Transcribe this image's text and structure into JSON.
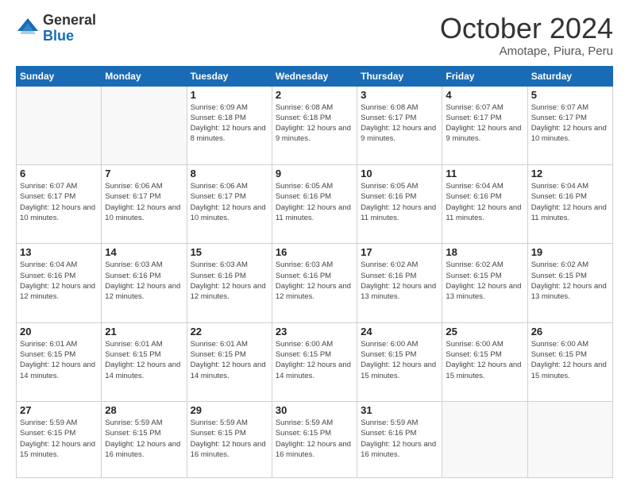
{
  "header": {
    "logo_general": "General",
    "logo_blue": "Blue",
    "month_year": "October 2024",
    "location": "Amotape, Piura, Peru"
  },
  "days_of_week": [
    "Sunday",
    "Monday",
    "Tuesday",
    "Wednesday",
    "Thursday",
    "Friday",
    "Saturday"
  ],
  "weeks": [
    [
      {
        "day": "",
        "info": ""
      },
      {
        "day": "",
        "info": ""
      },
      {
        "day": "1",
        "info": "Sunrise: 6:09 AM\nSunset: 6:18 PM\nDaylight: 12 hours and 8 minutes."
      },
      {
        "day": "2",
        "info": "Sunrise: 6:08 AM\nSunset: 6:18 PM\nDaylight: 12 hours and 9 minutes."
      },
      {
        "day": "3",
        "info": "Sunrise: 6:08 AM\nSunset: 6:17 PM\nDaylight: 12 hours and 9 minutes."
      },
      {
        "day": "4",
        "info": "Sunrise: 6:07 AM\nSunset: 6:17 PM\nDaylight: 12 hours and 9 minutes."
      },
      {
        "day": "5",
        "info": "Sunrise: 6:07 AM\nSunset: 6:17 PM\nDaylight: 12 hours and 10 minutes."
      }
    ],
    [
      {
        "day": "6",
        "info": "Sunrise: 6:07 AM\nSunset: 6:17 PM\nDaylight: 12 hours and 10 minutes."
      },
      {
        "day": "7",
        "info": "Sunrise: 6:06 AM\nSunset: 6:17 PM\nDaylight: 12 hours and 10 minutes."
      },
      {
        "day": "8",
        "info": "Sunrise: 6:06 AM\nSunset: 6:17 PM\nDaylight: 12 hours and 10 minutes."
      },
      {
        "day": "9",
        "info": "Sunrise: 6:05 AM\nSunset: 6:16 PM\nDaylight: 12 hours and 11 minutes."
      },
      {
        "day": "10",
        "info": "Sunrise: 6:05 AM\nSunset: 6:16 PM\nDaylight: 12 hours and 11 minutes."
      },
      {
        "day": "11",
        "info": "Sunrise: 6:04 AM\nSunset: 6:16 PM\nDaylight: 12 hours and 11 minutes."
      },
      {
        "day": "12",
        "info": "Sunrise: 6:04 AM\nSunset: 6:16 PM\nDaylight: 12 hours and 11 minutes."
      }
    ],
    [
      {
        "day": "13",
        "info": "Sunrise: 6:04 AM\nSunset: 6:16 PM\nDaylight: 12 hours and 12 minutes."
      },
      {
        "day": "14",
        "info": "Sunrise: 6:03 AM\nSunset: 6:16 PM\nDaylight: 12 hours and 12 minutes."
      },
      {
        "day": "15",
        "info": "Sunrise: 6:03 AM\nSunset: 6:16 PM\nDaylight: 12 hours and 12 minutes."
      },
      {
        "day": "16",
        "info": "Sunrise: 6:03 AM\nSunset: 6:16 PM\nDaylight: 12 hours and 12 minutes."
      },
      {
        "day": "17",
        "info": "Sunrise: 6:02 AM\nSunset: 6:16 PM\nDaylight: 12 hours and 13 minutes."
      },
      {
        "day": "18",
        "info": "Sunrise: 6:02 AM\nSunset: 6:15 PM\nDaylight: 12 hours and 13 minutes."
      },
      {
        "day": "19",
        "info": "Sunrise: 6:02 AM\nSunset: 6:15 PM\nDaylight: 12 hours and 13 minutes."
      }
    ],
    [
      {
        "day": "20",
        "info": "Sunrise: 6:01 AM\nSunset: 6:15 PM\nDaylight: 12 hours and 14 minutes."
      },
      {
        "day": "21",
        "info": "Sunrise: 6:01 AM\nSunset: 6:15 PM\nDaylight: 12 hours and 14 minutes."
      },
      {
        "day": "22",
        "info": "Sunrise: 6:01 AM\nSunset: 6:15 PM\nDaylight: 12 hours and 14 minutes."
      },
      {
        "day": "23",
        "info": "Sunrise: 6:00 AM\nSunset: 6:15 PM\nDaylight: 12 hours and 14 minutes."
      },
      {
        "day": "24",
        "info": "Sunrise: 6:00 AM\nSunset: 6:15 PM\nDaylight: 12 hours and 15 minutes."
      },
      {
        "day": "25",
        "info": "Sunrise: 6:00 AM\nSunset: 6:15 PM\nDaylight: 12 hours and 15 minutes."
      },
      {
        "day": "26",
        "info": "Sunrise: 6:00 AM\nSunset: 6:15 PM\nDaylight: 12 hours and 15 minutes."
      }
    ],
    [
      {
        "day": "27",
        "info": "Sunrise: 5:59 AM\nSunset: 6:15 PM\nDaylight: 12 hours and 15 minutes."
      },
      {
        "day": "28",
        "info": "Sunrise: 5:59 AM\nSunset: 6:15 PM\nDaylight: 12 hours and 16 minutes."
      },
      {
        "day": "29",
        "info": "Sunrise: 5:59 AM\nSunset: 6:15 PM\nDaylight: 12 hours and 16 minutes."
      },
      {
        "day": "30",
        "info": "Sunrise: 5:59 AM\nSunset: 6:15 PM\nDaylight: 12 hours and 16 minutes."
      },
      {
        "day": "31",
        "info": "Sunrise: 5:59 AM\nSunset: 6:16 PM\nDaylight: 12 hours and 16 minutes."
      },
      {
        "day": "",
        "info": ""
      },
      {
        "day": "",
        "info": ""
      }
    ]
  ]
}
